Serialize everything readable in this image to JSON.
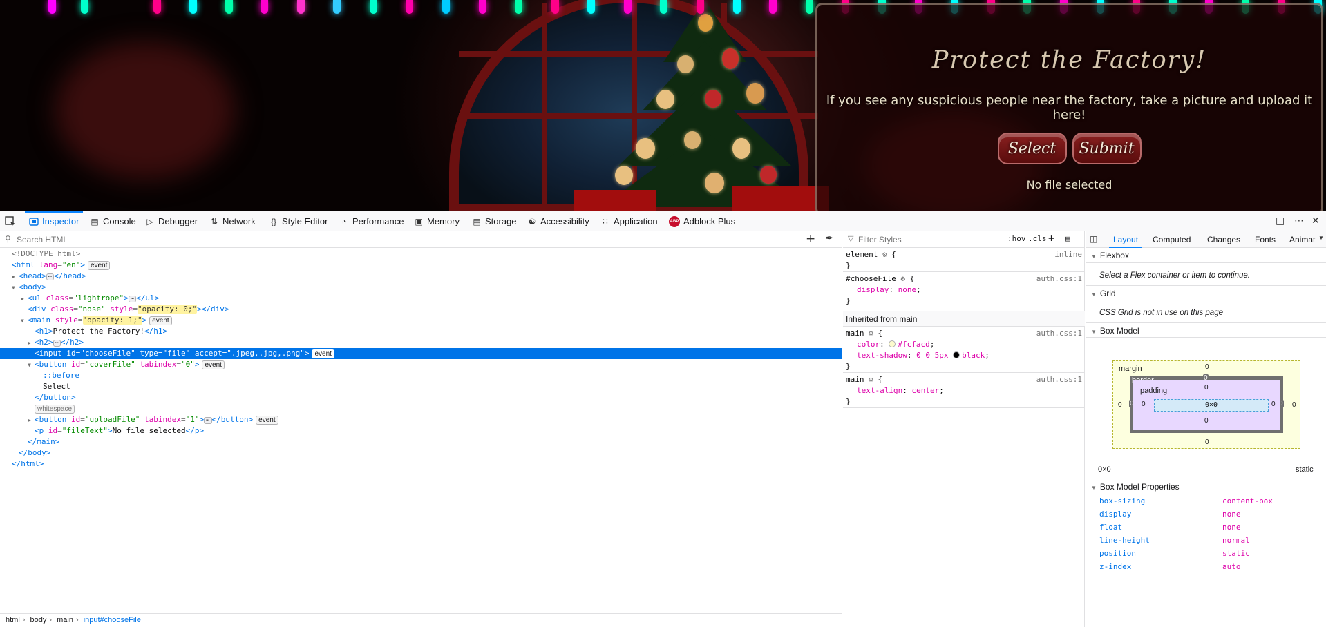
{
  "site": {
    "title": "Protect the Factory!",
    "subtitle": "If you see any suspicious people near the factory, take a picture and upload it here!",
    "select_label": "Select",
    "submit_label": "Submit",
    "file_text": "No file selected"
  },
  "toolbar": {
    "tabs": [
      {
        "label": "Inspector",
        "icon": "inspector-icon"
      },
      {
        "label": "Console",
        "icon": "console-icon"
      },
      {
        "label": "Debugger",
        "icon": "debugger-icon"
      },
      {
        "label": "Network",
        "icon": "network-icon"
      },
      {
        "label": "Style Editor",
        "icon": "style-editor-icon"
      },
      {
        "label": "Performance",
        "icon": "performance-icon"
      },
      {
        "label": "Memory",
        "icon": "memory-icon"
      },
      {
        "label": "Storage",
        "icon": "storage-icon"
      },
      {
        "label": "Accessibility",
        "icon": "accessibility-icon"
      },
      {
        "label": "Application",
        "icon": "application-icon"
      },
      {
        "label": "Adblock Plus",
        "icon": "adblock-plus-icon"
      }
    ]
  },
  "markup": {
    "search_placeholder": "Search HTML",
    "lines": {
      "doctype": "<!DOCTYPE html>",
      "html_open": "html",
      "html_lang_attr": "lang",
      "html_lang_val": "\"en\"",
      "head": "head",
      "body": "body",
      "ul": "ul",
      "ul_class_val": "\"lightrope\"",
      "div": "div",
      "div_class_val": "\"nose\"",
      "div_style_val": "\"opacity: 0;\"",
      "main": "main",
      "main_style_val": "\"opacity: 1;\"",
      "h1": "h1",
      "h1_text": "Protect the Factory!",
      "h2": "h2",
      "input": "input",
      "input_id_val": "\"chooseFile\"",
      "input_type_val": "\"file\"",
      "input_accept_val": "\".jpeg,.jpg,.png\"",
      "button": "button",
      "cover_id_val": "\"coverFile\"",
      "cover_tabindex_val": "\"0\"",
      "before": "::before",
      "select_text": "Select",
      "whitespace": "whitespace",
      "upload_id_val": "\"uploadFile\"",
      "upload_tabindex_val": "\"1\"",
      "p": "p",
      "p_id_val": "\"fileText\"",
      "p_text": "No file selected",
      "event": "event",
      "ellipsis": "⋯"
    }
  },
  "breadcrumbs": [
    "html",
    "body",
    "main",
    "input#chooseFile"
  ],
  "rules": {
    "filter_placeholder": "Filter Styles",
    "hov": ":hov",
    "cls": ".cls",
    "element_selector": "element",
    "element_source": "inline",
    "rule1_selector": "#chooseFile",
    "rule1_source": "auth.css:1",
    "rule1_prop": "display",
    "rule1_value": "none",
    "inherited_header": "Inherited from main",
    "rule2_selector": "main",
    "rule2_source": "auth.css:1",
    "rule2_prop1": "color",
    "rule2_val1": "#fcfacd",
    "rule2_prop2": "text-shadow",
    "rule2_val2a": "0 0 5px",
    "rule2_val2b": "black",
    "rule3_selector": "main",
    "rule3_source": "auth.css:1",
    "rule3_prop": "text-align",
    "rule3_value": "center"
  },
  "layout": {
    "subtabs": [
      "Layout",
      "Computed",
      "Changes",
      "Fonts",
      "Animat"
    ],
    "flexbox_header": "Flexbox",
    "flexbox_msg": "Select a Flex container or item to continue.",
    "grid_header": "Grid",
    "grid_msg": "CSS Grid is not in use on this page",
    "boxmodel_header": "Box Model",
    "bm_margin": "margin",
    "bm_border": "border",
    "bm_padding": "padding",
    "bm_content": "0×0",
    "bm_zero": "0",
    "size_text": "0×0",
    "position_text": "static",
    "props_header": "Box Model Properties",
    "props": [
      {
        "name": "box-sizing",
        "value": "content-box"
      },
      {
        "name": "display",
        "value": "none"
      },
      {
        "name": "float",
        "value": "none"
      },
      {
        "name": "line-height",
        "value": "normal"
      },
      {
        "name": "position",
        "value": "static"
      },
      {
        "name": "z-index",
        "value": "auto"
      }
    ]
  },
  "colors": {
    "accent": "#0074e8",
    "selection": "#0074e8",
    "text_color_value": "#fcfacd"
  }
}
